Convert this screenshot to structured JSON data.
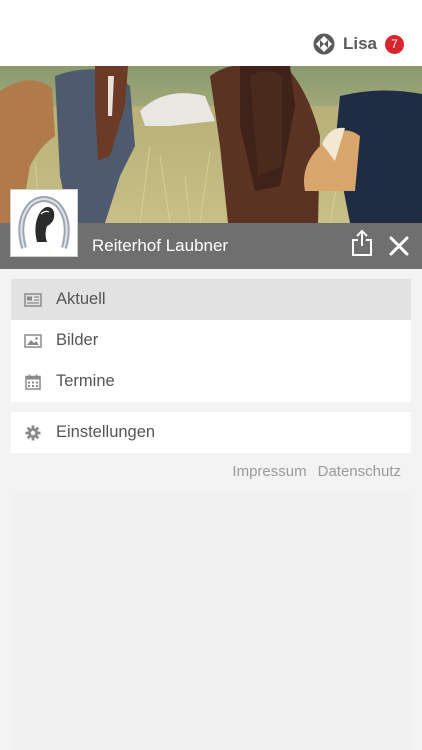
{
  "header": {
    "user_name": "Lisa",
    "notification_count": "7",
    "app_icon": "app-logo-icon"
  },
  "hero": {
    "club_name": "Reiterhof Laubner"
  },
  "menu": {
    "primary": [
      {
        "label": "Aktuell",
        "icon": "newspaper-icon",
        "active": true
      },
      {
        "label": "Bilder",
        "icon": "image-icon",
        "active": false
      },
      {
        "label": "Termine",
        "icon": "calendar-icon",
        "active": false
      }
    ],
    "secondary": [
      {
        "label": "Einstellungen",
        "icon": "gear-icon"
      }
    ]
  },
  "footer": {
    "impressum": "Impressum",
    "datenschutz": "Datenschutz"
  },
  "colors": {
    "badge": "#d9232d",
    "title_bar": "#6f6f6f",
    "active_item": "#e2e2e2"
  }
}
